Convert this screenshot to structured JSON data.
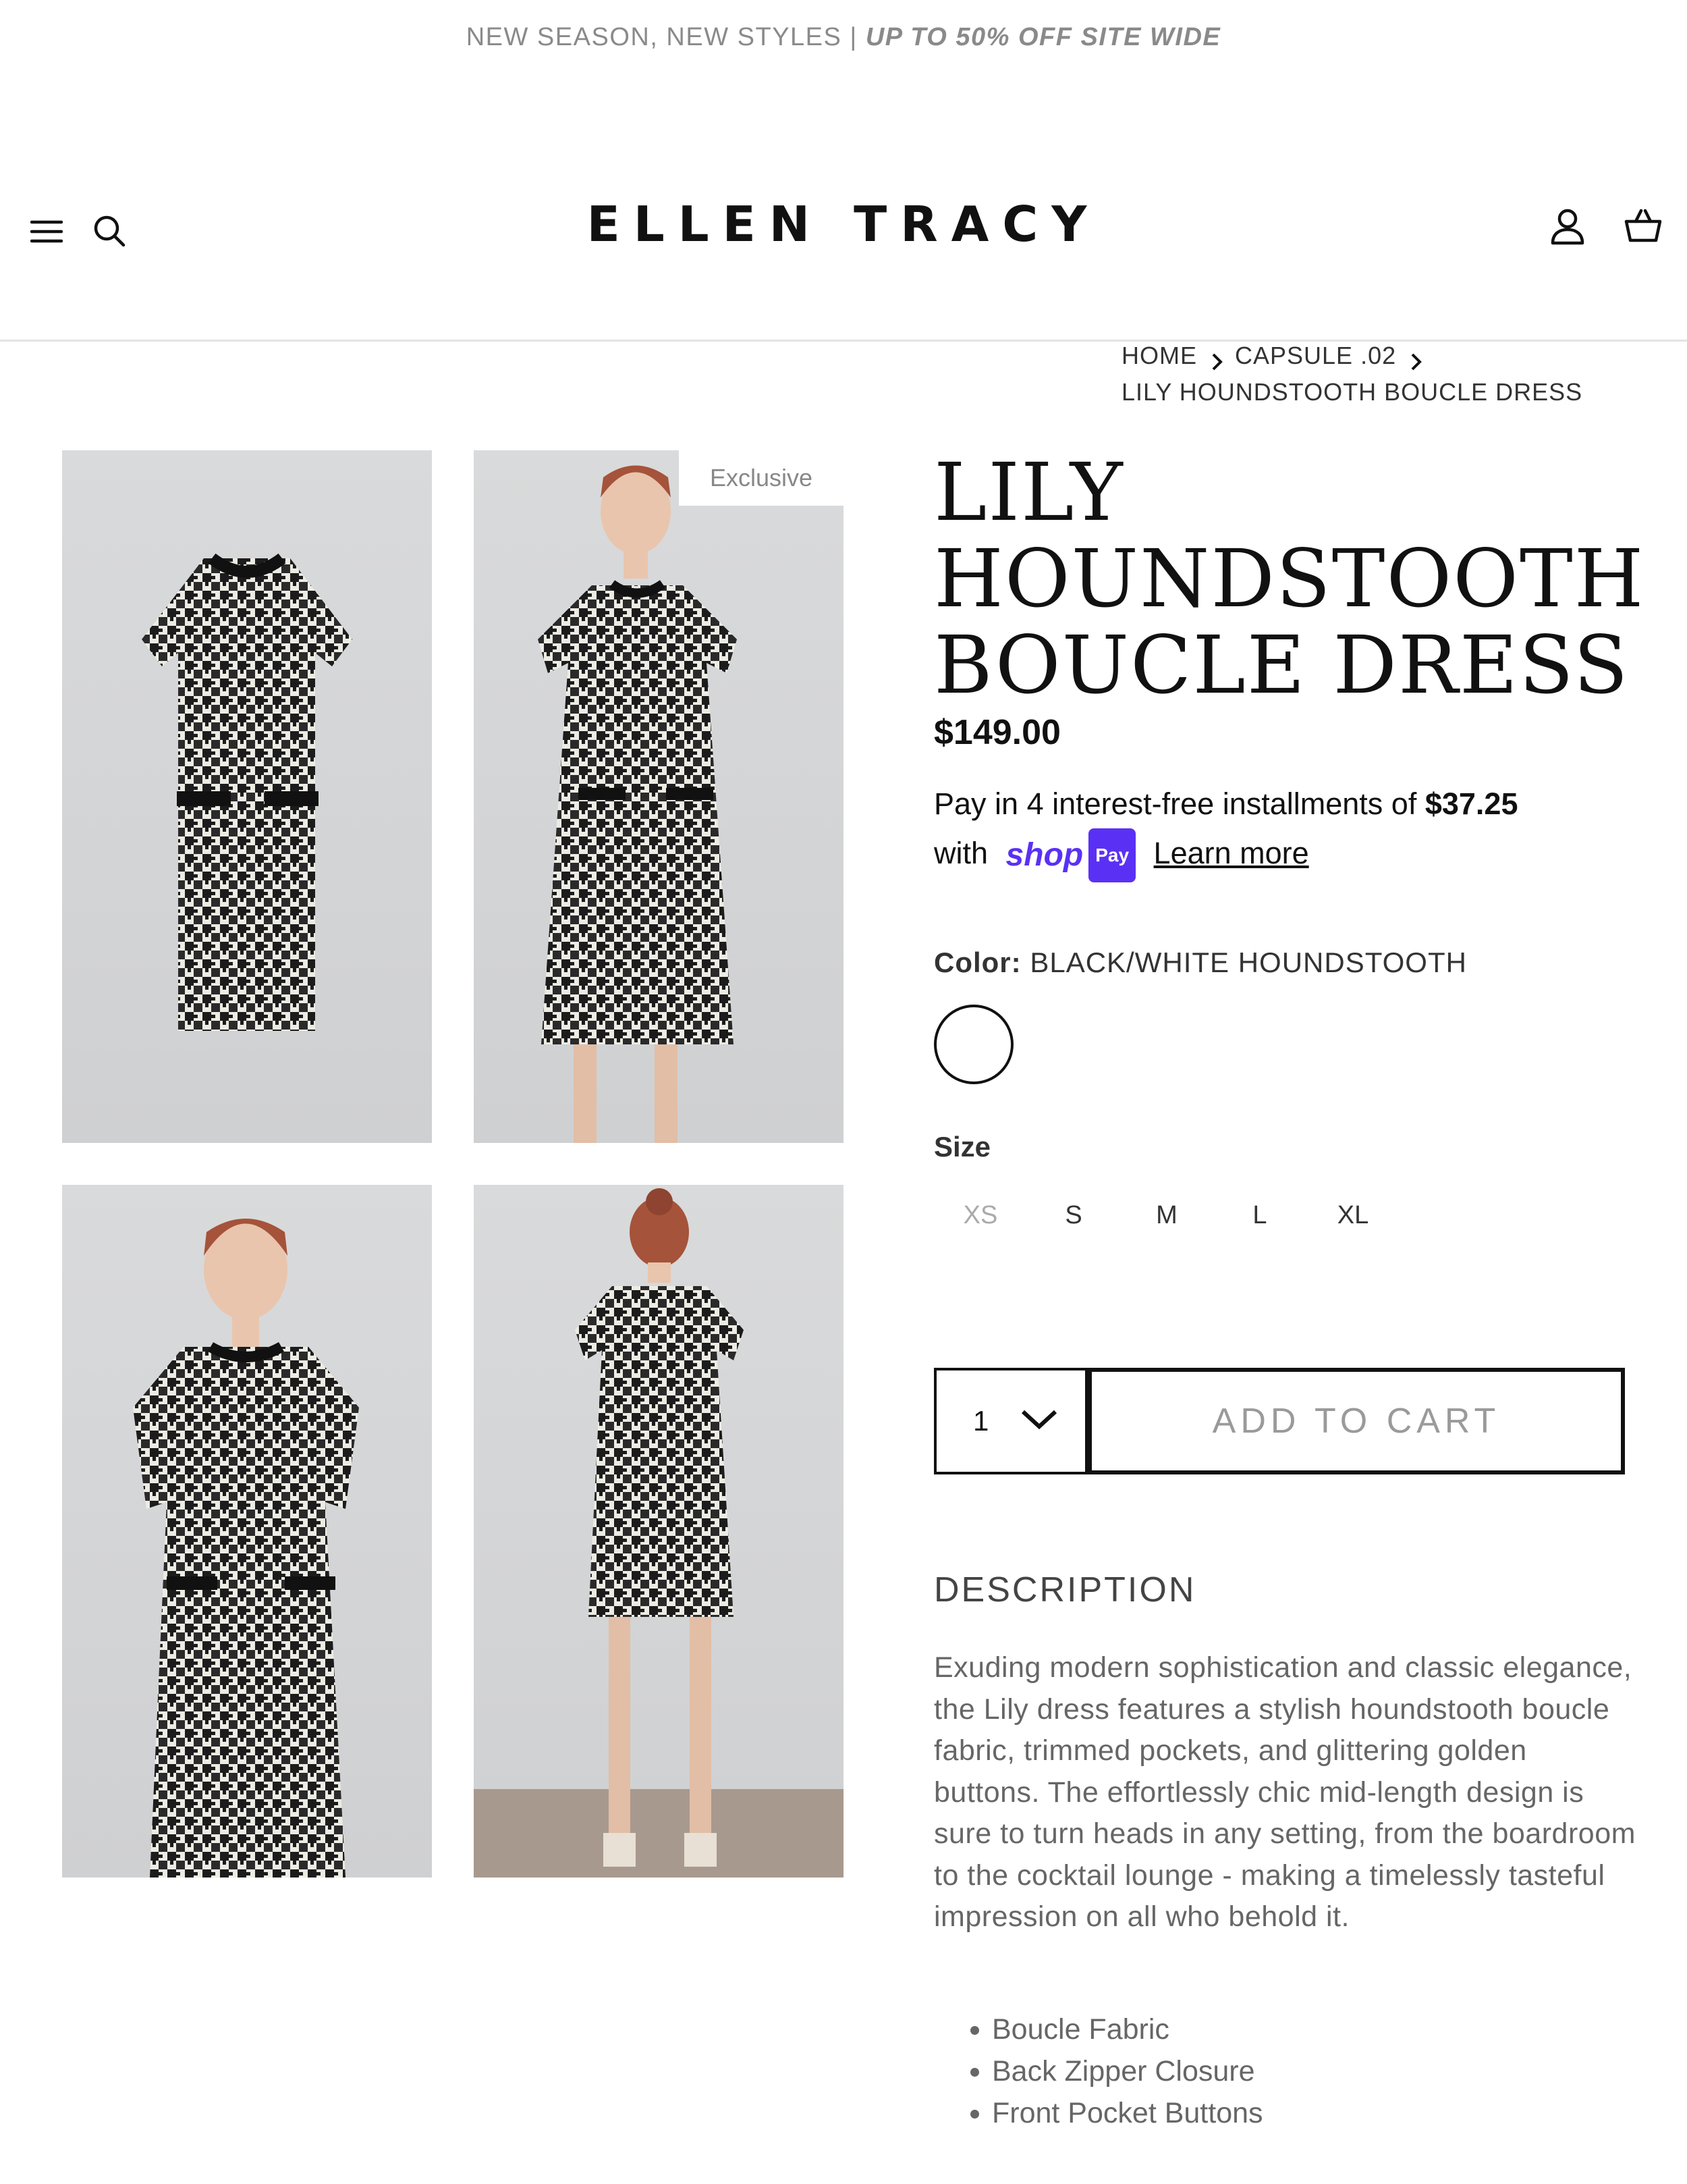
{
  "announcement": {
    "text": "NEW SEASON, NEW STYLES |",
    "promo": "UP TO 50% OFF SITE WIDE"
  },
  "header": {
    "logo": "ELLEN TRACY",
    "icons": [
      "menu-icon",
      "search-icon",
      "account-icon",
      "cart-icon"
    ]
  },
  "breadcrumb": {
    "home": "HOME",
    "collection": "CAPSULE .02",
    "current": "LILY HOUNDSTOOTH BOUCLE DRESS"
  },
  "gallery": {
    "badge": "Exclusive"
  },
  "product": {
    "title_lines": [
      "LILY",
      "HOUNDSTOOTH",
      "BOUCLE DRESS"
    ],
    "price": "$149.00",
    "installments_prefix": "Pay in 4 interest-free installments of",
    "installment_amount": "$37.25",
    "installments_with": "with",
    "shoppay_shop": "shop",
    "shoppay_pay": "Pay",
    "learn_more": "Learn more",
    "color_label": "Color:",
    "color_value": "BLACK/WHITE HOUNDSTOOTH",
    "size_label": "Size",
    "sizes": [
      "XS",
      "S",
      "M",
      "L",
      "XL"
    ],
    "quantity": "1",
    "add_to_cart": "ADD TO CART"
  },
  "description": {
    "heading": "DESCRIPTION",
    "text": "Exuding modern sophistication and classic elegance, the Lily dress features a stylish houndstooth boucle fabric, trimmed pockets, and glittering golden buttons. The effortlessly chic mid-length design is sure to turn heads in any setting, from the boardroom to the cocktail lounge - making a timelessly tasteful impression on all who behold it.",
    "bullets": [
      "Boucle Fabric",
      "Back Zipper Closure",
      "Front Pocket Buttons"
    ]
  },
  "colors": {
    "accent": "#5a31f4",
    "text": "#111111",
    "muted": "#8a8a8a"
  }
}
